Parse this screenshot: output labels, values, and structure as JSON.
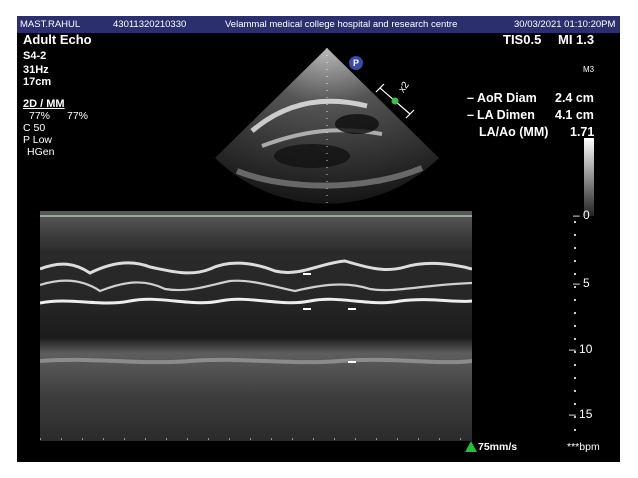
{
  "header": {
    "patient_name": "MAST.RAHUL",
    "patient_id": "43011320210330",
    "institution": "Velammal medical college hospital and research centre",
    "datetime": "30/03/2021 01:10:20PM"
  },
  "exam": {
    "preset": "Adult Echo",
    "probe": "S4-2",
    "frame_rate": "31Hz",
    "depth": "17cm",
    "mode": "2D / MM",
    "gain_2d": "77%",
    "gain_mm": "77%",
    "compression": "C 50",
    "power": "P Low",
    "frequency": "HGen"
  },
  "indices": {
    "tis": "TIS0.5",
    "mi": "MI 1.3",
    "map": "M3"
  },
  "zoom_marker": "x2",
  "probe_orientation_marker": "P",
  "measurements": [
    {
      "label": "AoR Diam",
      "value": "2.4 cm"
    },
    {
      "label": "LA Dimen",
      "value": "4.1 cm"
    },
    {
      "label": "LA/Ao (MM)",
      "value": "1.71"
    }
  ],
  "depth_scale": [
    "0",
    "5",
    "10",
    "15"
  ],
  "sweep_speed": "75mm/s",
  "heart_rate": "***bpm"
}
